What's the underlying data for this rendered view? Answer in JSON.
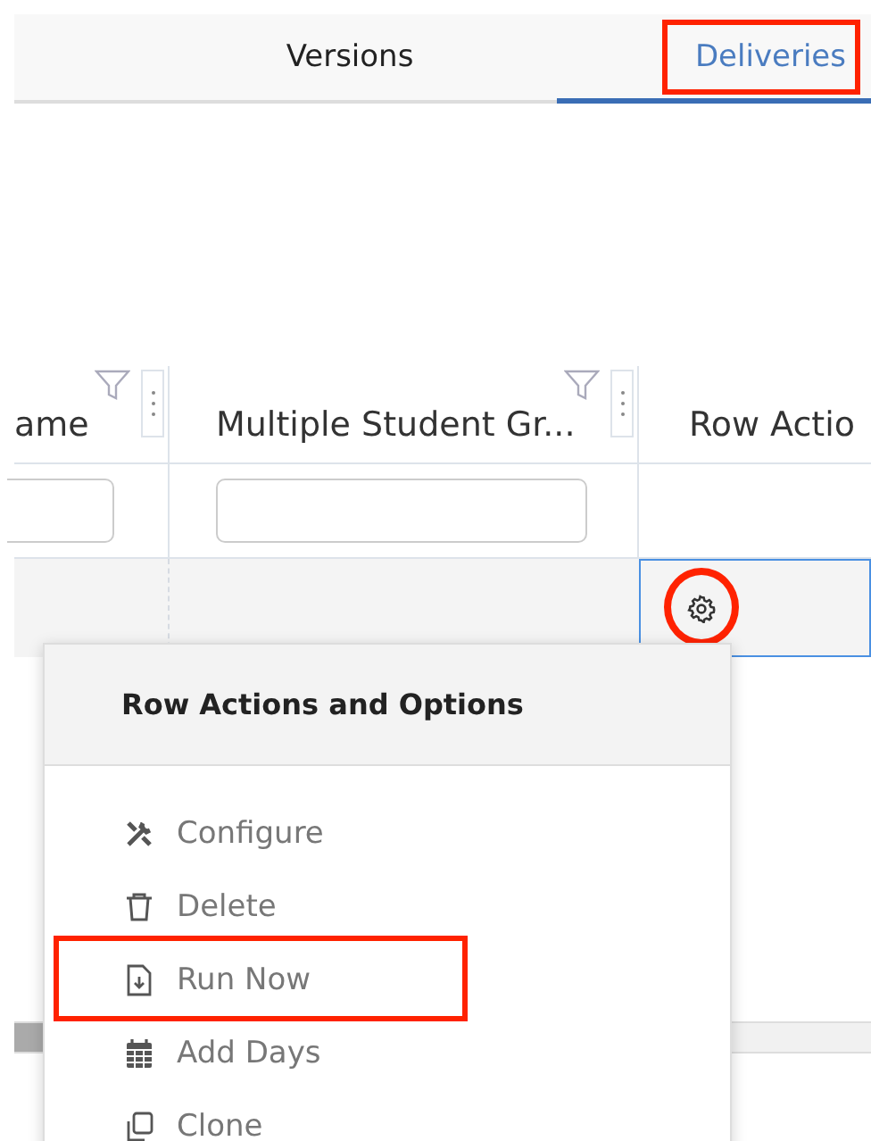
{
  "tabs": [
    {
      "label": "Versions",
      "selected": false,
      "highlighted": false
    },
    {
      "label": "Deliveries",
      "selected": true,
      "highlighted": true
    }
  ],
  "grid": {
    "columns": [
      {
        "header": "ame",
        "filterable": true
      },
      {
        "header": "Multiple Student Gr...",
        "filterable": true
      },
      {
        "header": "Row Actio",
        "filterable": false
      }
    ],
    "actions_cell": {
      "focused": true,
      "highlighted": true
    }
  },
  "menu": {
    "title": "Row Actions and Options",
    "items": [
      {
        "label": "Configure",
        "kind": "configure",
        "highlighted": false
      },
      {
        "label": "Delete",
        "kind": "delete",
        "highlighted": false
      },
      {
        "label": "Run Now",
        "kind": "run",
        "highlighted": true
      },
      {
        "label": "Add Days",
        "kind": "calendar",
        "highlighted": false
      },
      {
        "label": "Clone",
        "kind": "clone",
        "highlighted": false
      }
    ]
  }
}
